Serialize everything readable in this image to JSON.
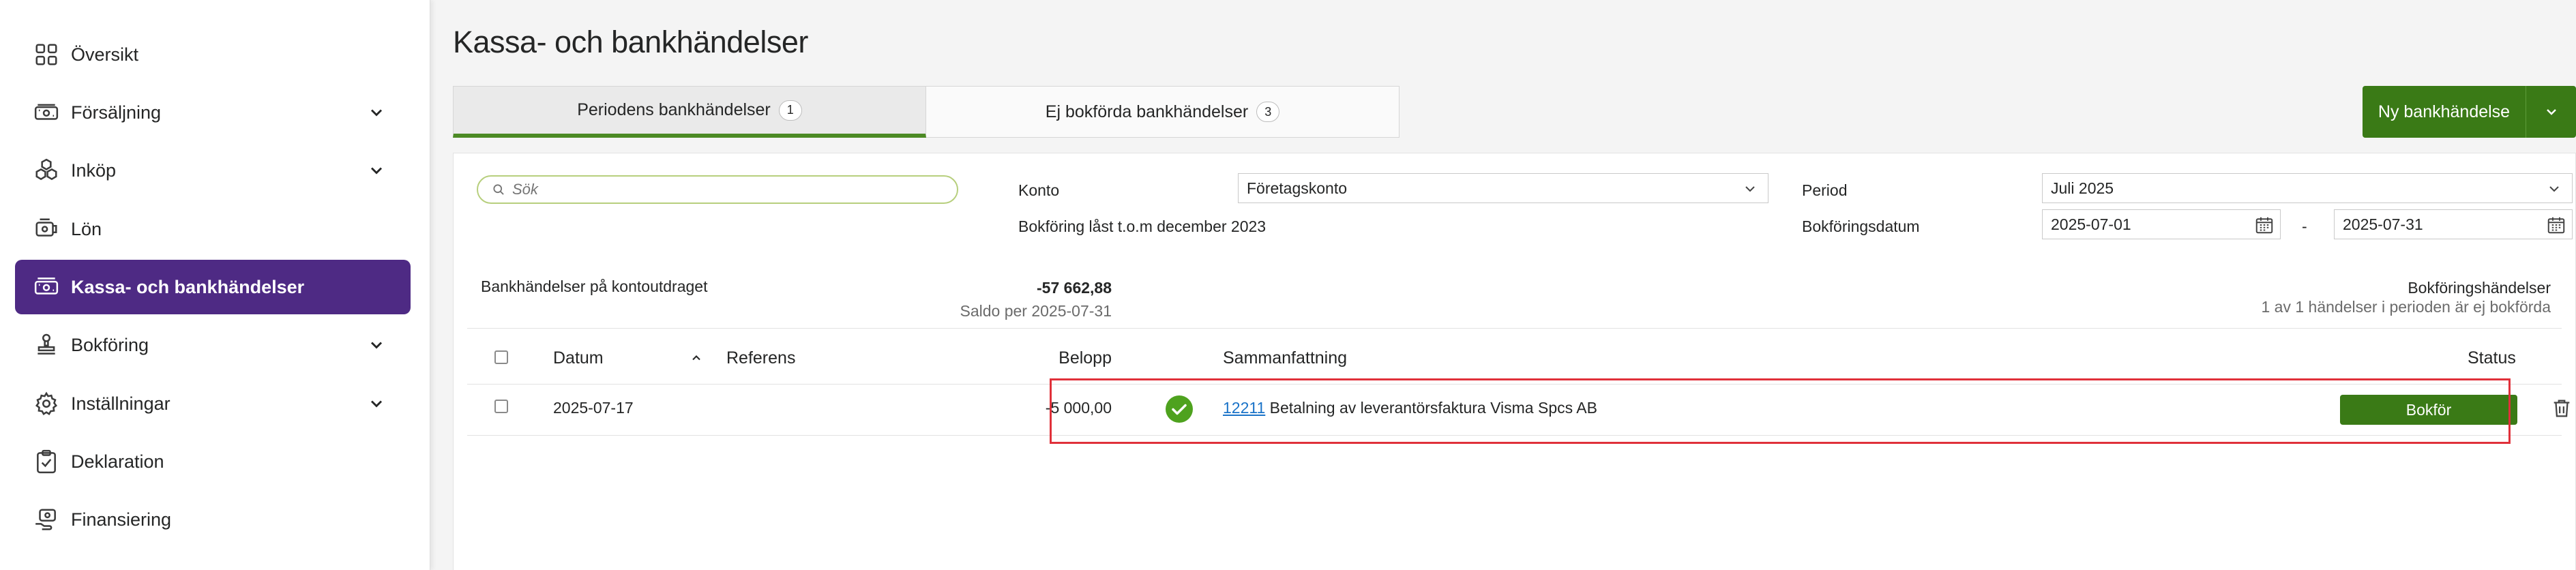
{
  "sidebar": {
    "items": [
      {
        "label": "Översikt",
        "icon": "grid-icon",
        "has_chevron": false
      },
      {
        "label": "Försäljning",
        "icon": "cash-register-icon",
        "has_chevron": true
      },
      {
        "label": "Inköp",
        "icon": "boxes-icon",
        "has_chevron": true
      },
      {
        "label": "Lön",
        "icon": "wallet-icon",
        "has_chevron": false
      },
      {
        "label": "Kassa- och bankhändelser",
        "icon": "bank-transfer-icon",
        "has_chevron": false,
        "active": true
      },
      {
        "label": "Bokföring",
        "icon": "stamp-icon",
        "has_chevron": true
      },
      {
        "label": "Inställningar",
        "icon": "gear-icon",
        "has_chevron": true
      },
      {
        "label": "Deklaration",
        "icon": "clipboard-check-icon",
        "has_chevron": false
      },
      {
        "label": "Finansiering",
        "icon": "money-hand-icon",
        "has_chevron": false
      }
    ]
  },
  "page": {
    "title": "Kassa- och bankhändelser"
  },
  "tabs": [
    {
      "label": "Periodens bankhändelser",
      "count": "1",
      "active": true
    },
    {
      "label": "Ej bokförda bankhändelser",
      "count": "3",
      "active": false
    }
  ],
  "actions": {
    "new_bank_event": "Ny bankhändelse"
  },
  "filters": {
    "search_placeholder": "Sök",
    "konto_label": "Konto",
    "konto_value": "Företagskonto",
    "locked_note": "Bokföring låst t.o.m december 2023",
    "period_label": "Period",
    "period_value": "Juli 2025",
    "bokforingsdatum_label": "Bokföringsdatum",
    "date_from": "2025-07-01",
    "date_separator": "-",
    "date_to": "2025-07-31"
  },
  "summary": {
    "left_label": "Bankhändelser på kontoutdraget",
    "amount": "-57 662,88",
    "saldo_note": "Saldo per 2025-07-31",
    "right_label": "Bokföringshändelser",
    "right_note": "1 av 1 händelser i perioden är ej bokförda"
  },
  "table": {
    "headers": {
      "datum": "Datum",
      "referens": "Referens",
      "belopp": "Belopp",
      "sammanfattning": "Sammanfattning",
      "status": "Status"
    },
    "rows": [
      {
        "datum": "2025-07-17",
        "referens": "",
        "belopp": "-5 000,00",
        "link": "12211",
        "description": "Betalning av leverantörsfaktura Visma Spcs AB",
        "action": "Bokför"
      }
    ]
  },
  "colors": {
    "accent_purple": "#4e2a84",
    "primary_green": "#3a7a16",
    "tab_underline": "#4c8a24",
    "highlight_red": "#e0303a",
    "check_green": "#4ea21e",
    "link_blue": "#1a73c8"
  }
}
